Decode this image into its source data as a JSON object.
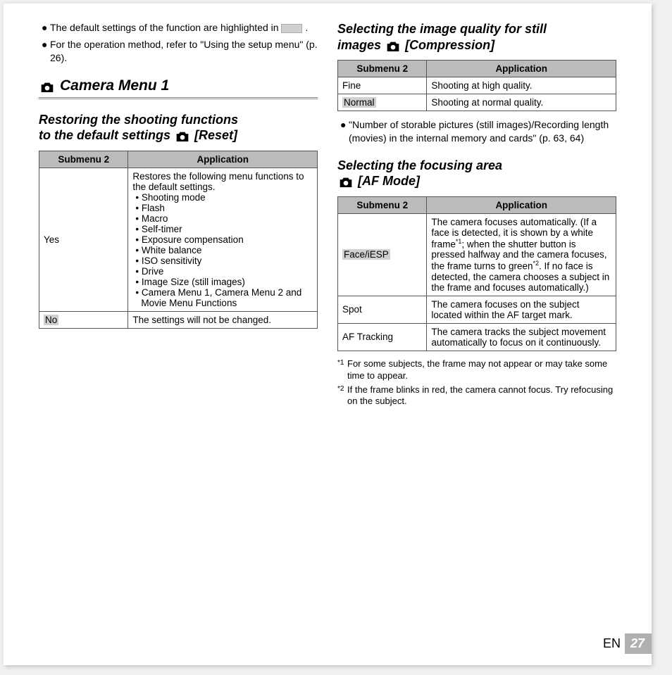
{
  "intro": {
    "bullet1_a": "The default settings of the function are highlighted in ",
    "bullet1_b": ".",
    "bullet2": "For the operation method, refer to \"Using the setup menu\" (p. 26)."
  },
  "main_heading": "Camera Menu 1",
  "section_reset": {
    "heading_line1": "Restoring the shooting functions",
    "heading_line2": "to the default settings ",
    "heading_line3": " [Reset]",
    "header_col1": "Submenu 2",
    "header_col2": "Application",
    "row1_sub": "Yes",
    "row1_app_intro": "Restores the following menu functions to the default settings.",
    "row1_items": {
      "i1": "• Shooting mode",
      "i2": "• Flash",
      "i3": "• Macro",
      "i4": "• Self-timer",
      "i5": "• Exposure compensation",
      "i6": "• White balance",
      "i7": "• ISO sensitivity",
      "i8": "• Drive",
      "i9": "• Image Size (still images)",
      "i10": "• Camera Menu 1, Camera Menu 2 and Movie Menu Functions"
    },
    "row2_sub": "No",
    "row2_app": "The settings will not be changed."
  },
  "section_compression": {
    "heading_line1": "Selecting the image quality for still",
    "heading_line2": "images ",
    "heading_line3": " [Compression]",
    "header_col1": "Submenu 2",
    "header_col2": "Application",
    "row1_sub": "Fine",
    "row1_app": "Shooting at high quality.",
    "row2_sub": "Normal",
    "row2_app": "Shooting at normal quality.",
    "note": "\"Number of storable pictures (still images)/Recording length (movies) in the internal memory and cards\" (p. 63, 64)"
  },
  "section_af": {
    "heading_line1": "Selecting the focusing area",
    "heading_line2": " [AF Mode]",
    "header_col1": "Submenu 2",
    "header_col2": "Application",
    "row1_sub": "Face/iESP",
    "row1_app_a": "The camera focuses automatically. (If a face is detected, it is shown by a white frame",
    "row1_app_b": "; when the shutter button is pressed halfway and the camera focuses, the frame turns to green",
    "row1_app_c": ". If no face is detected, the camera chooses a subject in the frame and focuses automatically.)",
    "row2_sub": "Spot",
    "row2_app": "The camera focuses on the subject located within the AF target mark.",
    "row3_sub": "AF Tracking",
    "row3_app": "The camera tracks the subject movement automatically to focus on it continuously.",
    "fn1_mark": "*1",
    "fn1": "For some subjects, the frame may not appear or may take some time to appear.",
    "fn2_mark": "*2",
    "fn2": "If the frame blinks in red, the camera cannot focus. Try refocusing on the subject."
  },
  "footer": {
    "lang": "EN",
    "page": "27"
  },
  "sup1": "*1",
  "sup2": "*2"
}
